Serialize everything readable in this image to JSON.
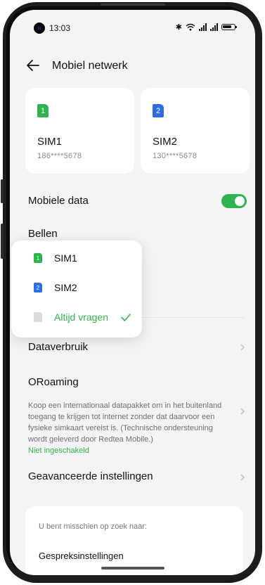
{
  "status_bar": {
    "time": "13:03"
  },
  "header": {
    "title": "Mobiel netwerk"
  },
  "sims": [
    {
      "badge": "1",
      "name": "SIM1",
      "number": "186****5678",
      "color": "#2fb34e"
    },
    {
      "badge": "2",
      "name": "SIM2",
      "number": "130****5678",
      "color": "#2e6be6"
    }
  ],
  "mobile_data": {
    "label": "Mobiele data",
    "enabled": true
  },
  "calls": {
    "label": "Bellen",
    "options": [
      {
        "badge": "1",
        "label": "SIM1"
      },
      {
        "badge": "2",
        "label": "SIM2"
      },
      {
        "label": "Altijd vragen",
        "selected": true
      }
    ]
  },
  "data_usage": {
    "label": "Dataverbruik"
  },
  "oroaming": {
    "label": "ORoaming",
    "description": "Koop een internationaal datapakket om in het buitenland toegang te krijgen tot internet zonder dat daarvoor een fysieke simkaart vereist is. (Technische ondersteuning wordt geleverd door Redtea Mobile.)",
    "status": "Niet ingeschakeld"
  },
  "advanced": {
    "label": "Geavanceerde instellingen"
  },
  "suggestions": {
    "heading": "U bent misschien op zoek naar:",
    "items": [
      "Gespreksinstellingen"
    ]
  },
  "colors": {
    "accent": "#2fb34e",
    "sim2": "#2e6be6",
    "background": "#f4f4f4"
  }
}
